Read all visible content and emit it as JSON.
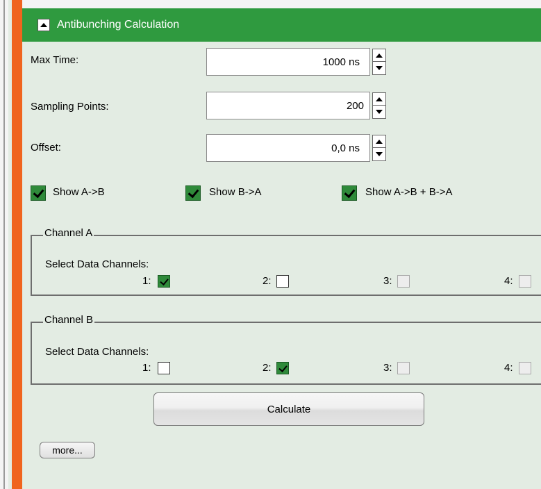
{
  "header": {
    "title": "Antibunching Calculation"
  },
  "fields": [
    {
      "label": "Max Time:",
      "value": "1000 ns"
    },
    {
      "label": "Sampling Points:",
      "value": "200"
    },
    {
      "label": "Offset:",
      "value": "0,0 ns"
    }
  ],
  "show_options": [
    {
      "label": "Show A->B",
      "checked": true
    },
    {
      "label": "Show B->A",
      "checked": true
    },
    {
      "label": "Show A->B + B->A",
      "checked": true
    }
  ],
  "channel_a": {
    "title": "Channel A",
    "select_label": "Select Data Channels:",
    "channels": [
      {
        "label": "1:",
        "checked": true,
        "enabled": true
      },
      {
        "label": "2:",
        "checked": false,
        "enabled": true
      },
      {
        "label": "3:",
        "checked": false,
        "enabled": false
      },
      {
        "label": "4:",
        "checked": false,
        "enabled": false
      }
    ]
  },
  "channel_b": {
    "title": "Channel B",
    "select_label": "Select Data Channels:",
    "channels": [
      {
        "label": "1:",
        "checked": false,
        "enabled": true
      },
      {
        "label": "2:",
        "checked": true,
        "enabled": true
      },
      {
        "label": "3:",
        "checked": false,
        "enabled": false
      },
      {
        "label": "4:",
        "checked": false,
        "enabled": false
      }
    ]
  },
  "buttons": {
    "calculate": "Calculate",
    "more": "more..."
  },
  "colors": {
    "header": "#2f9a3f",
    "accent_bar": "#f0641e",
    "panel_bg": "#e3ece3",
    "check_green": "#2f8a3a"
  }
}
